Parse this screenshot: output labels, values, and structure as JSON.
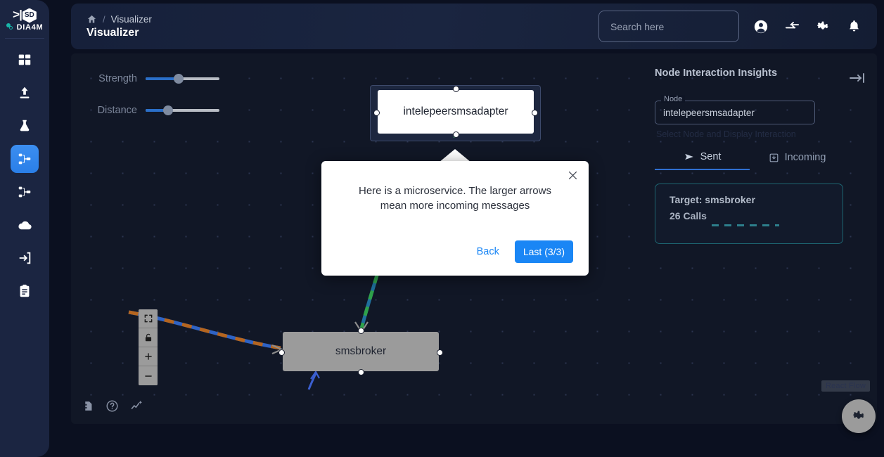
{
  "brand": {
    "arrow": ">|",
    "hex_text": "SD",
    "name": "DIA4M"
  },
  "sidebar": {
    "items": [
      {
        "name": "dashboard",
        "icon": "grid-icon"
      },
      {
        "name": "upload",
        "icon": "upload-icon"
      },
      {
        "name": "experiments",
        "icon": "flask-icon"
      },
      {
        "name": "visualizer",
        "icon": "sitemap-icon",
        "active": true
      },
      {
        "name": "topology",
        "icon": "sitemap-outline-icon"
      },
      {
        "name": "cloud",
        "icon": "cloud-icon"
      },
      {
        "name": "login",
        "icon": "login-icon"
      },
      {
        "name": "reports",
        "icon": "clipboard-icon"
      }
    ]
  },
  "header": {
    "breadcrumb_home": "home-icon",
    "breadcrumb_sep": "/",
    "breadcrumb_current": "Visualizer",
    "title": "Visualizer",
    "search": {
      "value": "",
      "placeholder": "Search here"
    },
    "icons": [
      "account-circle-icon",
      "sync-arrows-icon",
      "gear-icon",
      "bell-icon"
    ]
  },
  "canvas": {
    "sliders": [
      {
        "label": "Strength",
        "fill_pct": 45,
        "thumb_pct": 45
      },
      {
        "label": "Distance",
        "fill_pct": 30,
        "thumb_pct": 30
      }
    ],
    "nodes": [
      {
        "id": "intelepeersmsadapter",
        "label": "intelepeersmsadapter",
        "style": "white",
        "selected": true
      },
      {
        "id": "smsbroker",
        "label": "smsbroker",
        "style": "grey",
        "selected": false
      }
    ],
    "controls": [
      {
        "name": "fit-view",
        "icon": "fit-screen-icon"
      },
      {
        "name": "toggle-interactivity",
        "icon": "lock-icon"
      },
      {
        "name": "zoom-in",
        "icon": "plus-icon"
      },
      {
        "name": "zoom-out",
        "icon": "minus-icon"
      }
    ],
    "bottom_icons": [
      {
        "name": "document",
        "icon": "file-icon"
      },
      {
        "name": "help",
        "icon": "help-circle-icon"
      },
      {
        "name": "insights",
        "icon": "analytics-sparkle-icon"
      }
    ],
    "attribution": "React Flow",
    "fab": {
      "name": "reset-flow",
      "icon": "gear-icon"
    }
  },
  "insights": {
    "title": "Node Interaction Insights",
    "collapse_icon": "arrow-to-right-icon",
    "node_field": {
      "legend": "Node",
      "value": "intelepeersmsadapter"
    },
    "helper_text": "Select Node and Display Interaction",
    "tabs": [
      {
        "label": "Sent",
        "icon": "send-icon",
        "active": true
      },
      {
        "label": "Incoming",
        "icon": "inbox-icon",
        "active": false
      }
    ],
    "target_card": {
      "title": "Target: smsbroker",
      "calls": "26 Calls"
    }
  },
  "tour": {
    "text": "Here is a microservice. The larger arrows mean more incoming messages",
    "back_label": "Back",
    "next_label": "Last (3/3)",
    "close_icon": "close-icon"
  },
  "colors": {
    "accent_blue": "#1a86f5",
    "sidebar_bg": "#1b2541",
    "canvas_bg": "#111726",
    "teal_edge": "#2d7f8c",
    "orange_edge": "#b5651f"
  }
}
